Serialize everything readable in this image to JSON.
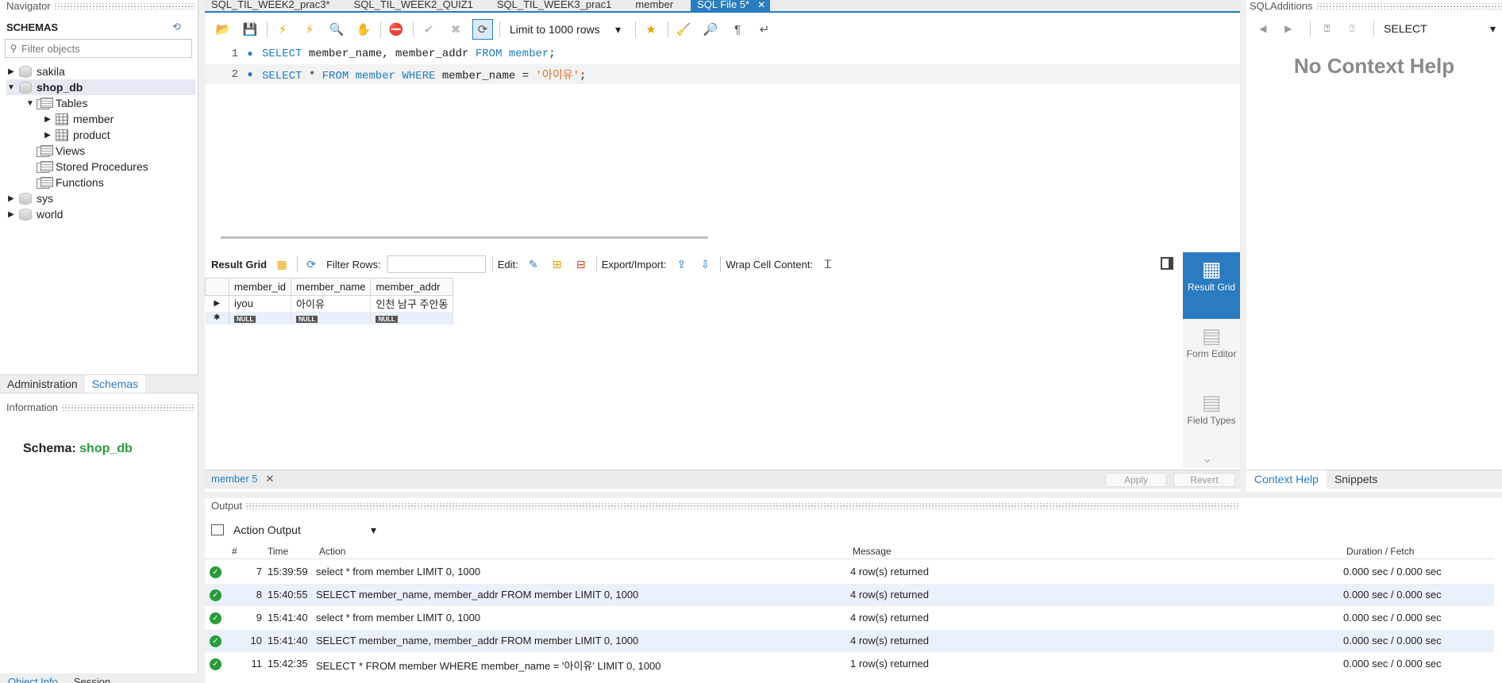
{
  "navigator": {
    "title": "Navigator",
    "schemas_label": "SCHEMAS",
    "filter_placeholder": "Filter objects",
    "tree": {
      "sakila": "sakila",
      "shop_db": "shop_db",
      "tables": "Tables",
      "member": "member",
      "product": "product",
      "views": "Views",
      "procedures": "Stored Procedures",
      "functions": "Functions",
      "sys": "sys",
      "world": "world"
    },
    "tabs": [
      "Administration",
      "Schemas"
    ],
    "information_title": "Information",
    "schema_label": "Schema:",
    "schema_value": "shop_db",
    "bottom_tabs": [
      "Object Info",
      "Session"
    ]
  },
  "editor_tabs": [
    "SQL_TIL_WEEK2_prac3*",
    "SQL_TIL_WEEK2_QUIZ1",
    "SQL_TIL_WEEK3_prac1",
    "member",
    "SQL File 5*"
  ],
  "toolbar": {
    "limit": "Limit to 1000 rows"
  },
  "code": {
    "lines": [
      {
        "num": "1",
        "k1": "SELECT",
        "t1": " member_name, member_addr ",
        "k2": "FROM",
        "t2": " ",
        "k3": "member",
        "t3": ";"
      },
      {
        "num": "2",
        "k1": "SELECT",
        "t1": " * ",
        "k2": "FROM",
        "t2": " ",
        "k3": "member",
        "t3": " ",
        "k4": "WHERE",
        "t4": " member_name = ",
        "s": "'아이유'",
        "t5": ";"
      }
    ]
  },
  "result_toolbar": {
    "result_grid": "Result Grid",
    "filter_rows": "Filter Rows:",
    "edit": "Edit:",
    "export": "Export/Import:",
    "wrap": "Wrap Cell Content:"
  },
  "grid": {
    "columns": [
      "member_id",
      "member_name",
      "member_addr"
    ],
    "rows": [
      [
        "iyou",
        "아이유",
        "인천 남구 주안동"
      ]
    ],
    "null": "NULL"
  },
  "result_side": {
    "result_grid": "Result Grid",
    "form_editor": "Form Editor",
    "field_types": "Field Types"
  },
  "result_bar": {
    "tab": "member 5",
    "apply": "Apply",
    "revert": "Revert"
  },
  "output": {
    "title": "Output",
    "mode": "Action Output",
    "headers": [
      "#",
      "Time",
      "Action",
      "Message",
      "Duration / Fetch"
    ],
    "rows": [
      {
        "n": "7",
        "time": "15:39:59",
        "action": "select * from member LIMIT 0, 1000",
        "msg": "4 row(s) returned",
        "dur": "0.000 sec / 0.000 sec"
      },
      {
        "n": "8",
        "time": "15:40:55",
        "action": "SELECT member_name, member_addr FROM member LIMIT 0, 1000",
        "msg": "4 row(s) returned",
        "dur": "0.000 sec / 0.000 sec"
      },
      {
        "n": "9",
        "time": "15:41:40",
        "action": "select * from member LIMIT 0, 1000",
        "msg": "4 row(s) returned",
        "dur": "0.000 sec / 0.000 sec"
      },
      {
        "n": "10",
        "time": "15:41:40",
        "action": "SELECT member_name, member_addr FROM member LIMIT 0, 1000",
        "msg": "4 row(s) returned",
        "dur": "0.000 sec / 0.000 sec"
      },
      {
        "n": "11",
        "time": "15:42:35",
        "action": "SELECT * FROM member WHERE member_name = '아이유' LIMIT 0, 1000",
        "msg": "1 row(s) returned",
        "dur": "0.000 sec / 0.000 sec"
      }
    ]
  },
  "sql_additions": {
    "title": "SQLAdditions",
    "context_select": "SELECT",
    "no_context": "No Context Help",
    "tabs": [
      "Context Help",
      "Snippets"
    ]
  },
  "colors": {
    "accent": "#2a7bc0",
    "success": "#2a9a3a"
  }
}
